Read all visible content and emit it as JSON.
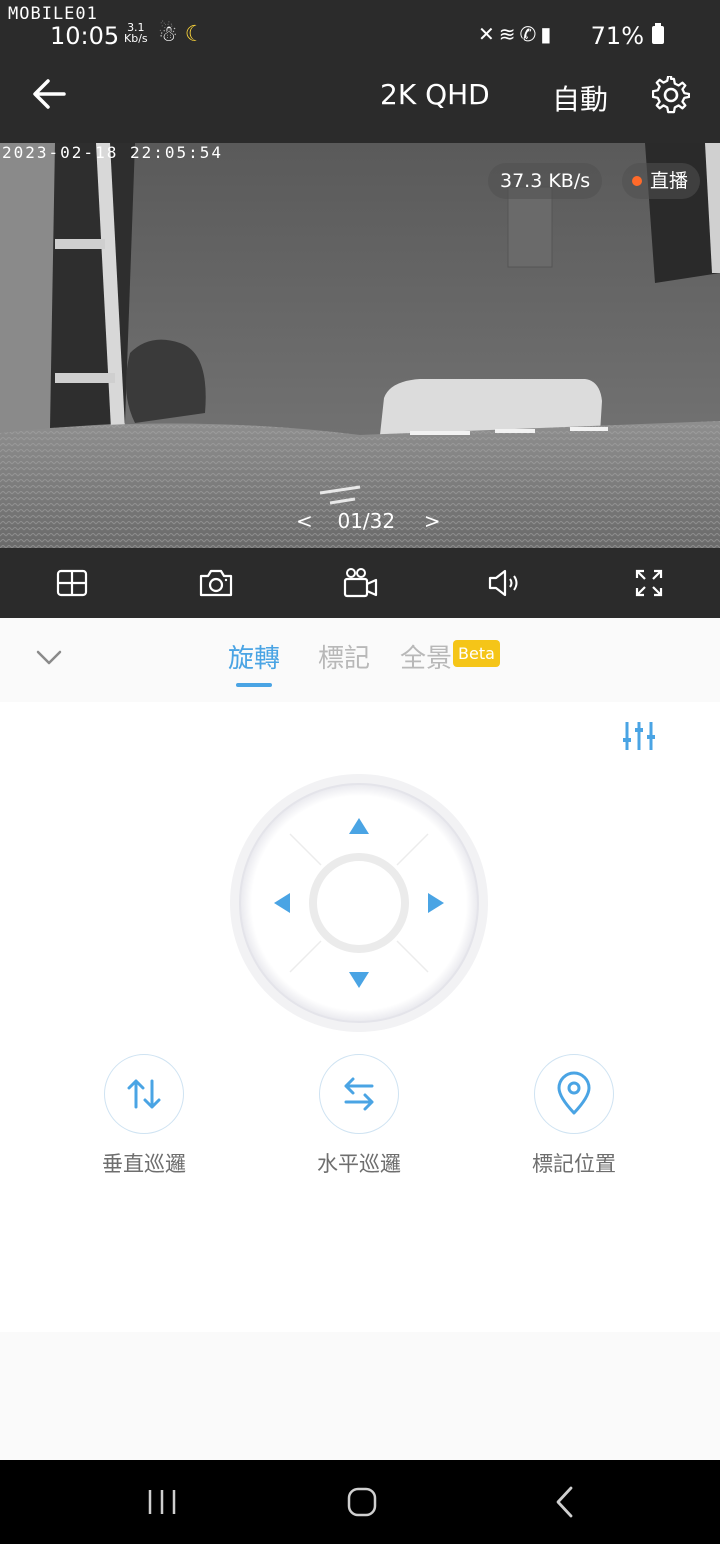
{
  "status_bar": {
    "watermark": "MOBILE01",
    "time": "10:05",
    "net_speed_value": "3.1",
    "net_speed_unit": "Kb/s",
    "battery": "71%"
  },
  "header": {
    "quality": "2K QHD",
    "mode": "自動"
  },
  "feed": {
    "timestamp": "2023-02-18 22:05:54",
    "bitrate": "37.3 KB/s",
    "live_label": "直播",
    "pager_prev": "<",
    "pager_text": "01/32",
    "pager_next": ">"
  },
  "tabs": [
    {
      "label": "旋轉",
      "active": true
    },
    {
      "label": "標記",
      "active": false
    },
    {
      "label": "全景",
      "active": false
    }
  ],
  "beta_badge": "Beta",
  "actions": [
    {
      "label": "垂直巡邏",
      "icon": "vertical-arrows-icon"
    },
    {
      "label": "水平巡邏",
      "icon": "horizontal-arrows-icon"
    },
    {
      "label": "標記位置",
      "icon": "map-pin-icon"
    }
  ],
  "colors": {
    "accent": "#4aa4e4",
    "beta": "#f5c518",
    "live_dot": "#ff6a2a",
    "dark_bar": "#2b2b2b"
  }
}
